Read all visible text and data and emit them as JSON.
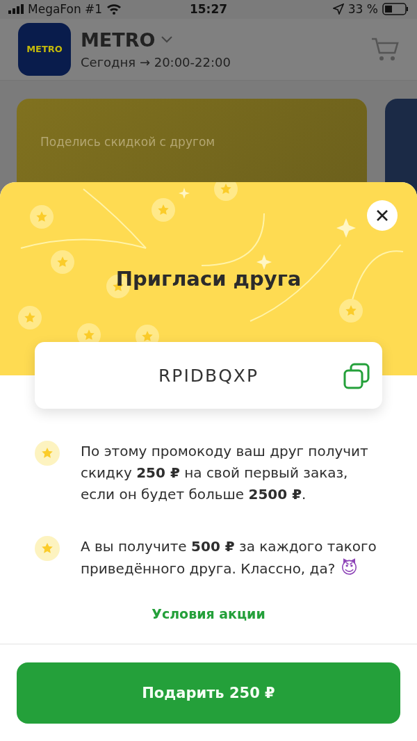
{
  "status_bar": {
    "carrier": "MegaFon #1",
    "time": "15:27",
    "battery": "33 %"
  },
  "header": {
    "logo_text": "METRO",
    "store": "METRO",
    "delivery": "Сегодня → 20:00-22:00"
  },
  "background_card": {
    "title": "Поделись скидкой с другом"
  },
  "sheet": {
    "title": "Пригласи друга",
    "promo_code": "RPIDBQXP",
    "items": [
      {
        "kind": "note",
        "text": "По этому промокоду ваш друг получит скидку **250 ₽** на свой первый заказ, если он будет больше **2500 ₽**."
      },
      {
        "kind": "note-with-emoji",
        "text": "А вы получите **500 ₽** за каждого такого приведённого друга. Классно, да?",
        "emoji": "😈"
      }
    ],
    "link": "Условия акции"
  },
  "button": "Подарить 250 ₽"
}
